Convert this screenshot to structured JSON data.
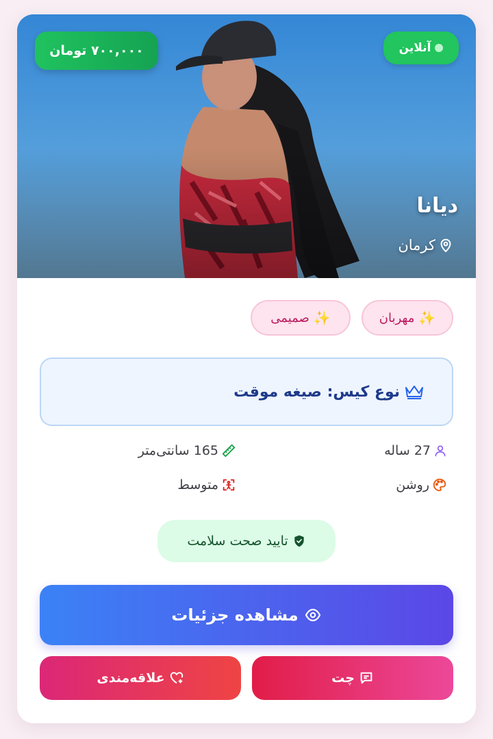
{
  "profile": {
    "price": "۷۰۰,۰۰۰ تومان",
    "status": "آنلاین",
    "name": "دیانا",
    "city": "کرمان"
  },
  "tags": [
    "مهربان",
    "صمیمی"
  ],
  "case": {
    "label": "نوع کیس: صیغه موقت"
  },
  "info": {
    "age": "27 ساله",
    "height": "165 سانتی‌متر",
    "skin": "روشن",
    "body": "متوسط"
  },
  "health": {
    "label": "تایید صحت سلامت"
  },
  "actions": {
    "details": "مشاهده جزئیات",
    "chat": "چت",
    "favorite": "علاقه‌مندی"
  },
  "colors": {
    "online": "#22c55e",
    "price_badge": "#15a352",
    "tag_bg": "#fde4ee",
    "tag_text": "#be185d",
    "case_text": "#1e3a8a",
    "details_start": "#3b82f6",
    "details_end": "#5b47e6",
    "chat": "#e11d48",
    "favorite": "#ef4444"
  },
  "icons": {
    "online": "status-dot-icon",
    "city": "location-pin-icon",
    "tag": "sparkles-icon",
    "case": "crown-icon",
    "age": "user-icon",
    "height": "ruler-icon",
    "skin": "palette-icon",
    "body": "body-icon",
    "health": "shield-check-icon",
    "details": "eye-icon",
    "chat": "chat-icon",
    "favorite": "heart-plus-icon"
  }
}
